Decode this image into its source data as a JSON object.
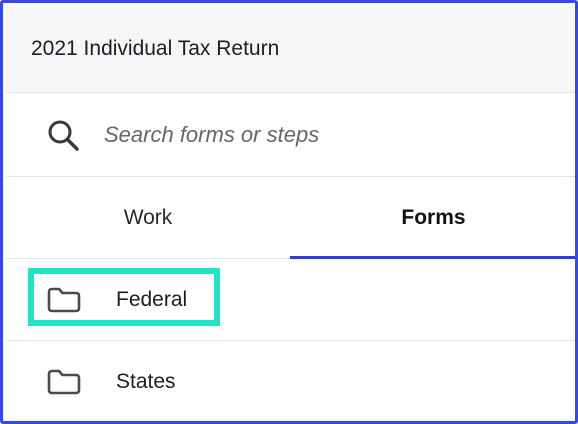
{
  "header": {
    "title": "2021 Individual Tax Return"
  },
  "search": {
    "placeholder": "Search forms or steps",
    "value": ""
  },
  "tabs": [
    {
      "label": "Work",
      "active": false
    },
    {
      "label": "Forms",
      "active": true
    }
  ],
  "items": [
    {
      "label": "Federal",
      "icon": "folder-icon",
      "highlighted": true
    },
    {
      "label": "States",
      "icon": "folder-icon",
      "highlighted": false
    }
  ],
  "colors": {
    "frame_border": "#3548e8",
    "active_tab_underline": "#2d3fd8",
    "highlight": "#1ee6c4",
    "header_bg": "#f6f6f8"
  }
}
